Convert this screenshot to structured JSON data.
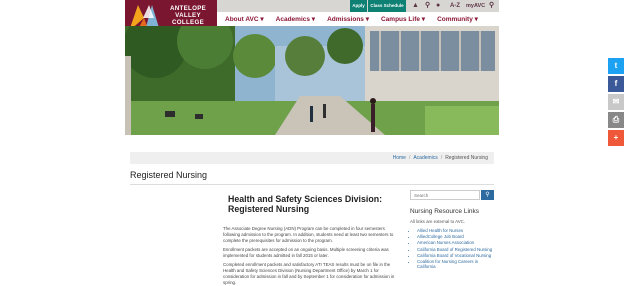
{
  "logo": {
    "line1": "ANTELOPE",
    "line2": "VALLEY",
    "line3": "COLLEGE"
  },
  "utility": {
    "apply": "Apply",
    "class_schedule": "Class Schedule",
    "az": "A-Z",
    "myavc": "myAVC"
  },
  "nav": {
    "items": [
      "About AVC",
      "Academics",
      "Admissions",
      "Campus Life",
      "Community"
    ]
  },
  "breadcrumb": [
    "Home",
    "Academics",
    "Registered Nursing"
  ],
  "page": {
    "title": "Registered Nursing"
  },
  "main": {
    "heading": "Health and Safety Sciences Division: Registered Nursing",
    "paragraphs": [
      "The Associate Degree Nursing (ADN) Program can be completed in four semesters following admission to the program. In addition, students need at least two semesters to complete the prerequisites for admission to the program.",
      "Enrollment packets are accepted on an ongoing basis. Multiple screening criteria was implemented for students admitted in fall 2015 or later.",
      "Completed enrollment packets and satisfactory ATI TEAS results must be on file in the Health and Safety Sciences Division (Nursing Department Office) by March 1 for consideration for admission in fall and by September 1 for consideration for admission in spring."
    ]
  },
  "sidebar": {
    "search_placeholder": "Search",
    "heading": "Nursing Resource Links",
    "subtext": "All links are external to AVC.",
    "links": [
      "Allied Health for Nurses",
      "AlliedCollege Job Board",
      "American Nurses Association",
      "California Board of Registered Nursing",
      "California Board of Vocational Nursing",
      "Coalition for Nursing Careers in California"
    ]
  },
  "colors": {
    "brand_maroon": "#7a1630",
    "nav_text": "#8a1535",
    "teal_button": "#0e8074",
    "link_blue": "#2c6aa0",
    "twitter": "#1da1f2",
    "facebook": "#3b5998",
    "print": "#888888",
    "plus": "#f0583a"
  },
  "social": [
    "twitter-icon",
    "facebook-icon",
    "email-icon",
    "print-icon",
    "share-plus-icon"
  ]
}
